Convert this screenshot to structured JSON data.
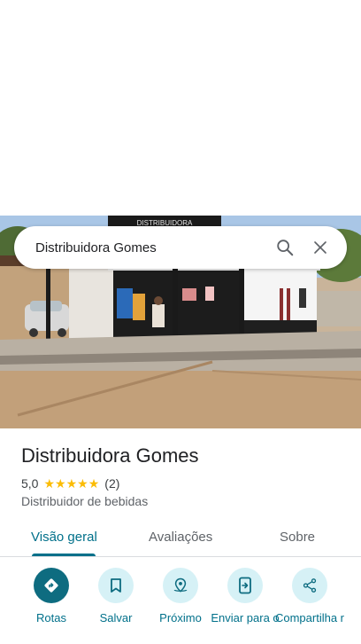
{
  "search": {
    "query": "Distribuidora Gomes",
    "search_icon": "search-icon",
    "close_icon": "close-icon"
  },
  "photo": {
    "sign_text": "DISTRIBUIDORA"
  },
  "place": {
    "title": "Distribuidora Gomes",
    "rating": "5,0",
    "stars": 5,
    "review_count": "(2)",
    "category": "Distribuidor de bebidas"
  },
  "tabs": [
    {
      "label": "Visão geral",
      "active": true
    },
    {
      "label": "Avaliações",
      "active": false
    },
    {
      "label": "Sobre",
      "active": false
    }
  ],
  "actions": [
    {
      "label": "Rotas",
      "icon": "directions-icon"
    },
    {
      "label": "Salvar",
      "icon": "bookmark-icon"
    },
    {
      "label": "Próximo",
      "icon": "nearby-icon"
    },
    {
      "label": "Enviar para o",
      "icon": "send-to-phone-icon"
    },
    {
      "label": "Compartilha r",
      "icon": "share-icon"
    }
  ],
  "colors": {
    "accent": "#00708a",
    "primary_action": "#0e6c80",
    "action_bg": "#d6f1f6",
    "star": "#fbbc04"
  }
}
